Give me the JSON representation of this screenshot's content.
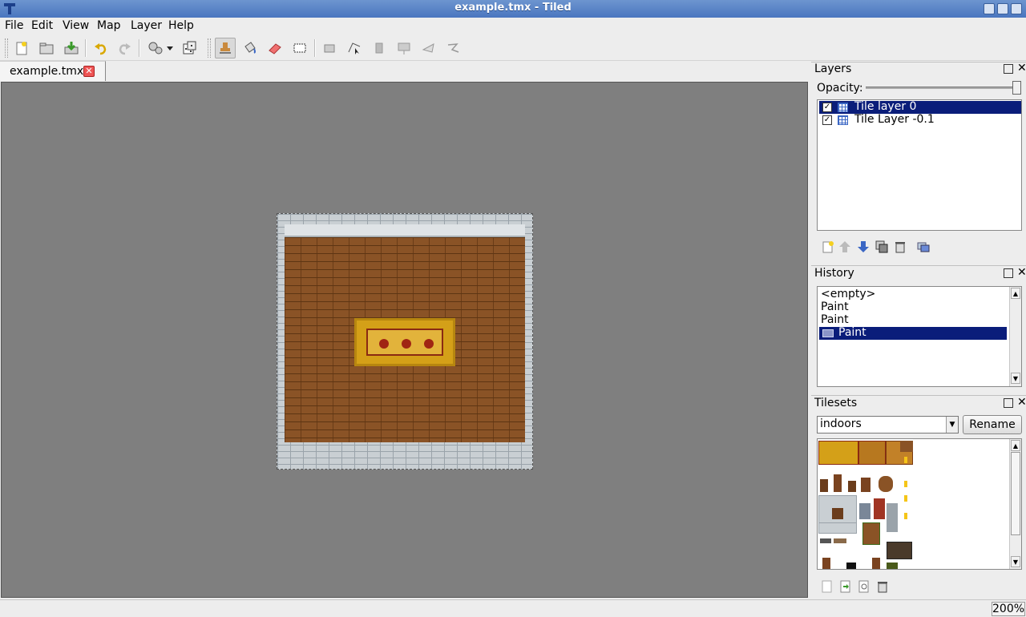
{
  "window": {
    "title": "example.tmx - Tiled"
  },
  "menu": {
    "file": "File",
    "edit": "Edit",
    "view": "View",
    "map": "Map",
    "layer": "Layer",
    "help": "Help"
  },
  "document": {
    "tab_label": "example.tmx",
    "close_symbol": "✕"
  },
  "layers_panel": {
    "title": "Layers",
    "opacity_label": "Opacity:",
    "opacity": 1.0,
    "layers": [
      {
        "name": "Tile layer 0",
        "visible_mark": "✓",
        "selected": true
      },
      {
        "name": "Tile Layer -0.1",
        "visible_mark": "✓",
        "selected": false
      }
    ]
  },
  "history_panel": {
    "title": "History",
    "entries": [
      "<empty>",
      "Paint",
      "Paint",
      "Paint"
    ],
    "selected_index": 3
  },
  "tilesets_panel": {
    "title": "Tilesets",
    "current_tileset": "indoors",
    "rename_label": "Rename"
  },
  "status": {
    "zoom": "200%"
  },
  "colors": {
    "selection": "#0a1d7a",
    "canvas_bg": "#7f7f7f",
    "titlebar": "#5a84c7"
  }
}
